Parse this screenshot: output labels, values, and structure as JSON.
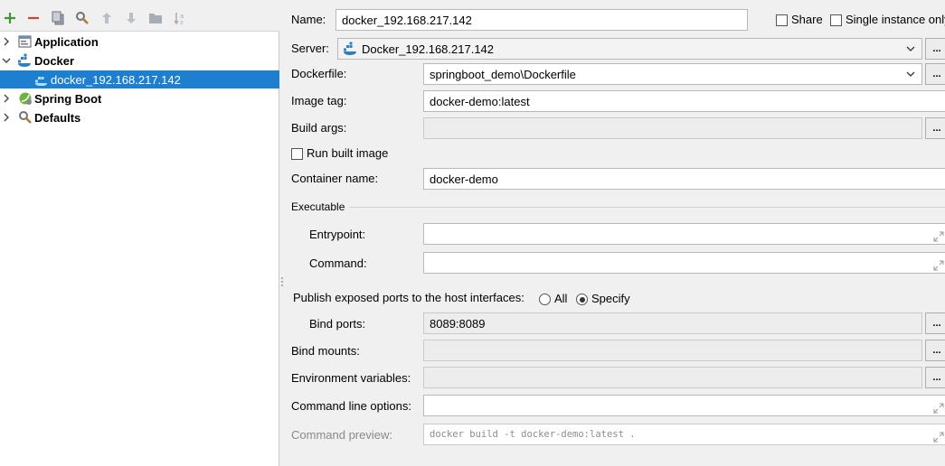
{
  "toolbar": {
    "icons": [
      "add-icon",
      "remove-icon",
      "copy-icon",
      "edit-defaults-icon",
      "move-up-icon",
      "move-down-icon",
      "folder-icon",
      "sort-icon"
    ]
  },
  "tree": {
    "items": [
      {
        "label": "Application",
        "icon": "application-icon"
      },
      {
        "label": "Docker",
        "icon": "docker-icon"
      },
      {
        "label": "docker_192.168.217.142",
        "icon": "docker-config-icon"
      },
      {
        "label": "Spring Boot",
        "icon": "spring-boot-icon"
      },
      {
        "label": "Defaults",
        "icon": "defaults-icon"
      }
    ]
  },
  "form": {
    "name_label": "Name:",
    "name_value": "docker_192.168.217.142",
    "share_label": "Share",
    "single_instance_label": "Single instance only",
    "server_label": "Server:",
    "server_value": "Docker_192.168.217.142",
    "dockerfile_label": "Dockerfile:",
    "dockerfile_value": "springboot_demo\\Dockerfile",
    "image_tag_label": "Image tag:",
    "image_tag_value": "docker-demo:latest",
    "build_args_label": "Build args:",
    "build_args_value": "",
    "run_built_image_label": "Run built image",
    "container_name_label": "Container name:",
    "container_name_value": "docker-demo",
    "executable_label": "Executable",
    "entrypoint_label": "Entrypoint:",
    "entrypoint_value": "",
    "command_label": "Command:",
    "command_value": "",
    "publish_label": "Publish exposed ports to the host interfaces:",
    "all_label": "All",
    "specify_label": "Specify",
    "bind_ports_label": "Bind ports:",
    "bind_ports_value": "8089:8089",
    "bind_mounts_label": "Bind mounts:",
    "bind_mounts_value": "",
    "env_vars_label": "Environment variables:",
    "env_vars_value": "",
    "cmd_options_label": "Command line options:",
    "cmd_options_value": "",
    "cmd_preview_label": "Command preview:",
    "cmd_preview_value": "docker build -t docker-demo:latest .",
    "browse_label": "..."
  },
  "colors": {
    "selection": "#1e7fd0",
    "add_green": "#3a9a2f",
    "remove_red": "#d6412c",
    "docker_blue": "#2d7fc0"
  }
}
